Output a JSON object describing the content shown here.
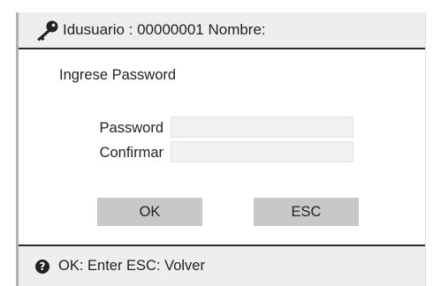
{
  "header": {
    "icon": "key-icon",
    "text": "Idusuario : 00000001 Nombre:"
  },
  "form": {
    "prompt": "Ingrese Password",
    "password_label": "Password",
    "password_value": "",
    "confirm_label": "Confirmar",
    "confirm_value": ""
  },
  "buttons": {
    "ok_label": "OK",
    "esc_label": "ESC"
  },
  "footer": {
    "icon": "help-icon",
    "help_glyph": "?",
    "text": "OK: Enter ESC: Volver"
  },
  "colors": {
    "bar_background": "#eeeeee",
    "button_background": "#c8c8c8",
    "input_background": "#f1f1f1",
    "divider": "#2a2a2a"
  }
}
